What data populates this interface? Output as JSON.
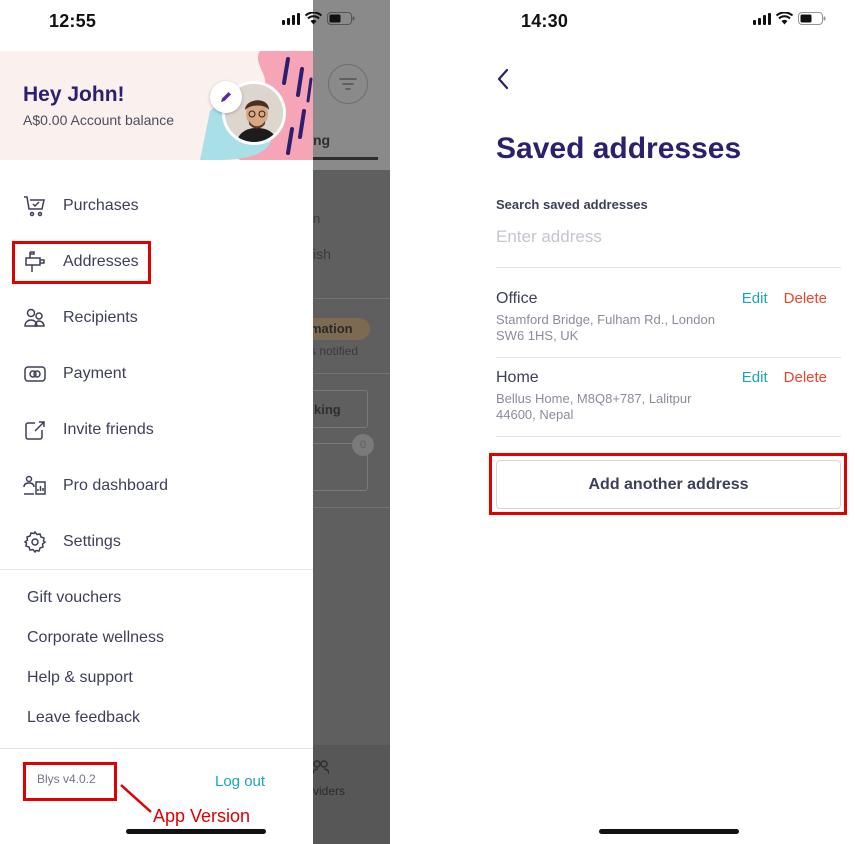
{
  "left_screen": {
    "status_time": "12:55",
    "greeting": "Hey John!",
    "balance": "A$0.00 Account balance",
    "menu_items": [
      {
        "label": "Purchases",
        "icon": "cart-icon"
      },
      {
        "label": "Addresses",
        "icon": "mailbox-icon"
      },
      {
        "label": "Recipients",
        "icon": "people-icon"
      },
      {
        "label": "Payment",
        "icon": "card-icon"
      },
      {
        "label": "Invite friends",
        "icon": "share-icon"
      },
      {
        "label": "Pro dashboard",
        "icon": "pro-dashboard-icon"
      },
      {
        "label": "Settings",
        "icon": "gear-icon"
      }
    ],
    "links": [
      "Gift vouchers",
      "Corporate wellness",
      "Help & support",
      "Leave feedback"
    ],
    "version": "Blys v4.0.2",
    "logout": "Log out",
    "annotation": "App Version",
    "background_fragments": {
      "tab": "ng",
      "line1": "n",
      "line2": "ish",
      "pill": "mation",
      "notified": "s notified",
      "button": "king",
      "badge": "0",
      "bottom": "viders"
    }
  },
  "right_screen": {
    "status_time": "14:30",
    "title": "Saved addresses",
    "search_label": "Search saved addresses",
    "search_placeholder": "Enter address",
    "addresses": [
      {
        "name": "Office",
        "line1": "Stamford Bridge, Fulham Rd., London",
        "line2": "SW6 1HS, UK",
        "edit": "Edit",
        "delete": "Delete"
      },
      {
        "name": "Home",
        "line1": "Bellus Home, M8Q8+787, Lalitpur",
        "line2": "44600, Nepal",
        "edit": "Edit",
        "delete": "Delete"
      }
    ],
    "add_button": "Add another address"
  },
  "colors": {
    "brand_purple": "#2b1f6e",
    "accent_teal": "#19a6b8",
    "delete_red": "#e8452f",
    "highlight_red": "#e00000"
  }
}
